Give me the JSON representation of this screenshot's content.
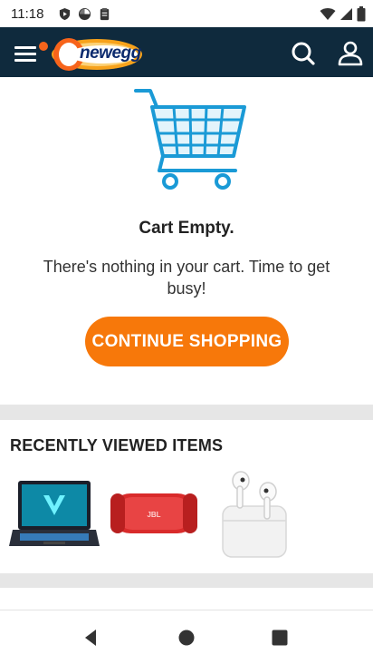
{
  "status_bar": {
    "time": "11:18",
    "app_icons": [
      "play-protect-icon",
      "pinwheel-icon",
      "clipboard-icon"
    ],
    "system_icons": [
      "wifi-icon",
      "signal-icon",
      "battery-icon"
    ]
  },
  "header": {
    "logo_text": "newegg",
    "menu_icon": "hamburger-menu-icon",
    "search_icon": "search-icon",
    "account_icon": "account-icon",
    "colors": {
      "background": "#0f2a3d",
      "accent": "#f7641b"
    }
  },
  "cart": {
    "illustration_icon": "shopping-cart-icon",
    "title": "Cart Empty.",
    "message": "There's nothing in your cart. Time to get busy!",
    "continue_label": "CONTINUE SHOPPING",
    "button_color": "#f7780a"
  },
  "recently_viewed": {
    "title": "RECENTLY VIEWED ITEMS",
    "items": [
      {
        "icon": "gaming-laptop-image"
      },
      {
        "icon": "portable-speaker-image"
      },
      {
        "icon": "wireless-earbuds-image"
      }
    ]
  },
  "nav_bar": {
    "buttons": [
      "back-icon",
      "home-icon",
      "recents-icon"
    ]
  }
}
